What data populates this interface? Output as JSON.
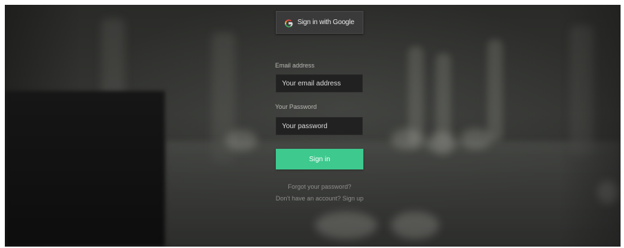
{
  "login": {
    "google_button_label": "Sign in with Google",
    "email": {
      "label": "Email address",
      "placeholder": "Your email address",
      "value": ""
    },
    "password": {
      "label": "Your Password",
      "placeholder": "Your password",
      "value": ""
    },
    "submit_label": "Sign in",
    "links": {
      "forgot_password": "Forgot your password?",
      "sign_up": "Don't have an account? Sign up"
    }
  },
  "colors": {
    "accent": "#3ec98e",
    "input_bg": "#202120",
    "google_button_bg": "#3a3a3a"
  },
  "icons": {
    "google": "google-g-icon"
  }
}
